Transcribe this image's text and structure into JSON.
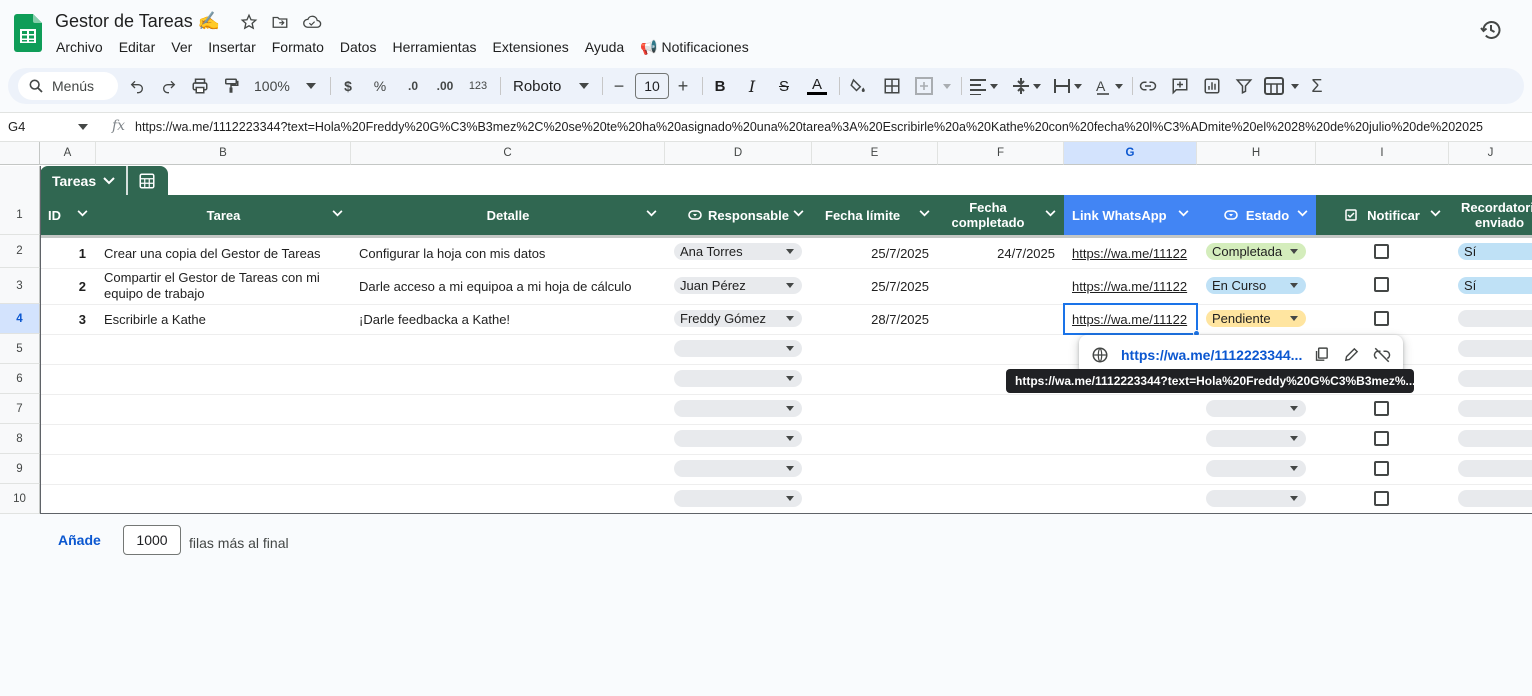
{
  "app": {
    "doc_title": "Gestor de Tareas ✍️",
    "menus": [
      "Archivo",
      "Editar",
      "Ver",
      "Insertar",
      "Formato",
      "Datos",
      "Herramientas",
      "Extensiones",
      "Ayuda",
      "📢 Notificaciones"
    ]
  },
  "toolbar": {
    "search_label": "Menús",
    "zoom": "100%",
    "currency": "$",
    "percent": "%",
    "dec_decrease": ".0",
    "dec_increase": ".00",
    "number_format": "123",
    "font": "Roboto",
    "font_size": "10",
    "minus": "−",
    "plus": "+"
  },
  "formula_bar": {
    "cell_ref": "G4",
    "fx": "fx",
    "value": "https://wa.me/1112223344?text=Hola%20Freddy%20G%C3%B3mez%2C%20se%20te%20ha%20asignado%20una%20tarea%3A%20Escribirle%20a%20Kathe%20con%20fecha%20l%C3%ADmite%20el%2028%20de%20julio%20de%202025"
  },
  "columns": [
    "A",
    "B",
    "C",
    "D",
    "E",
    "F",
    "G",
    "H",
    "I",
    "J"
  ],
  "rows": [
    "1",
    "2",
    "3",
    "4",
    "5",
    "6",
    "7",
    "8",
    "9",
    "10"
  ],
  "table": {
    "name": "Tareas",
    "headers": {
      "id": "ID",
      "tarea": "Tarea",
      "detalle": "Detalle",
      "responsable": "Responsable",
      "fecha_limite": "Fecha límite",
      "fecha_completado_1": "Fecha",
      "fecha_completado_2": "completado",
      "link": "Link WhatsApp",
      "estado": "Estado",
      "notificar": "Notificar",
      "recordatorio_1": "Recordatorio",
      "recordatorio_2": "enviado"
    },
    "data": [
      {
        "id": "1",
        "tarea": "Crear una copia del Gestor de Tareas",
        "tarea2": "",
        "detalle": "Configurar la hoja con mis datos",
        "responsable": "Ana Torres",
        "fecha_limite": "25/7/2025",
        "fecha_completado": "24/7/2025",
        "link": "https://wa.me/11122",
        "estado": "Completada",
        "recordatorio": "Sí"
      },
      {
        "id": "2",
        "tarea": "Compartir el Gestor de Tareas con mi",
        "tarea2": "equipo de trabajo",
        "detalle": "Darle acceso a mi equipoa a mi hoja de cálculo",
        "responsable": "Juan Pérez",
        "fecha_limite": "25/7/2025",
        "fecha_completado": "",
        "link": "https://wa.me/11122",
        "estado": "En Curso",
        "recordatorio": "Sí"
      },
      {
        "id": "3",
        "tarea": "Escribirle a Kathe",
        "tarea2": "",
        "detalle": "¡Darle feedbacka a Kathe!",
        "responsable": "Freddy Gómez",
        "fecha_limite": "28/7/2025",
        "fecha_completado": "",
        "link": "https://wa.me/11122",
        "estado": "Pendiente",
        "recordatorio": ""
      }
    ],
    "estado_colors": {
      "Completada": "#d4edbc",
      "En Curso": "#bfe1f6",
      "Pendiente": "#ffe5a0"
    },
    "header_color": "#306751",
    "selected_header_color": "#4285f4"
  },
  "link_popup": {
    "url": "https://wa.me/1112223344...",
    "tooltip": "https://wa.me/1112223344?text=Hola%20Freddy%20G%C3%B3mez%..."
  },
  "footer": {
    "add_label": "Añade",
    "add_count": "1000",
    "add_suffix": "filas más al final"
  }
}
